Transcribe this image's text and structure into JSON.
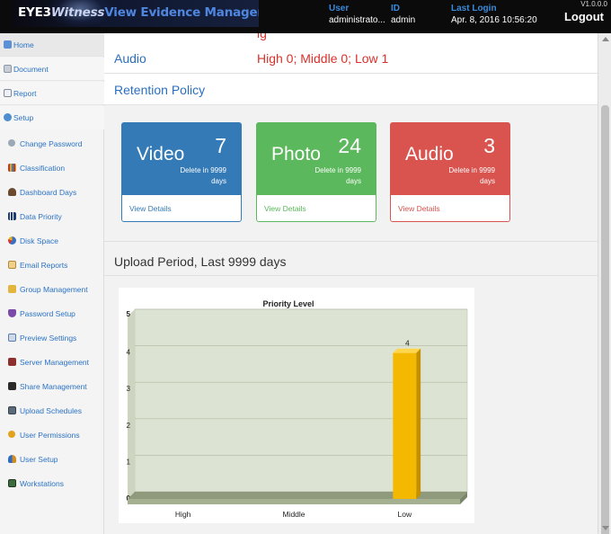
{
  "header": {
    "logo_eye": "EYE3",
    "logo_witness": "Witness",
    "logo_rest": "View Evidence Management Portal",
    "user_label": "User",
    "user_value": "administrato...",
    "id_label": "ID",
    "id_value": "admin",
    "login_label": "Last Login",
    "login_value": "Apr. 8, 2016 10:56:20",
    "version": "V1.0.0.0",
    "logout": "Logout"
  },
  "sidebar": {
    "top_items": [
      {
        "label": "Home",
        "icon": "home-icon"
      },
      {
        "label": "Document",
        "icon": "document-icon"
      },
      {
        "label": "Report",
        "icon": "report-icon"
      },
      {
        "label": "Setup",
        "icon": "setup-icon"
      }
    ],
    "sub_items": [
      {
        "label": "Change Password",
        "icon": "key-icon"
      },
      {
        "label": "Classification",
        "icon": "grid-icon"
      },
      {
        "label": "Dashboard Days",
        "icon": "user-icon"
      },
      {
        "label": "Data Priority",
        "icon": "bar-chart-icon"
      },
      {
        "label": "Disk Space",
        "icon": "pie-chart-icon"
      },
      {
        "label": "Email Reports",
        "icon": "email-icon"
      },
      {
        "label": "Group Management",
        "icon": "folder-icon"
      },
      {
        "label": "Password Setup",
        "icon": "shield-icon"
      },
      {
        "label": "Preview Settings",
        "icon": "preview-icon"
      },
      {
        "label": "Server Management",
        "icon": "server-icon"
      },
      {
        "label": "Share Management",
        "icon": "share-icon"
      },
      {
        "label": "Upload Schedules",
        "icon": "calendar-icon"
      },
      {
        "label": "User Permissions",
        "icon": "key-icon"
      },
      {
        "label": "User Setup",
        "icon": "users-icon"
      },
      {
        "label": "Workstations",
        "icon": "workstation-icon"
      }
    ]
  },
  "main": {
    "audio_label": "Audio",
    "audio_value": "High 0; Middle 0; Low 1",
    "retention_title": "Retention Policy",
    "tiles": [
      {
        "name": "Video",
        "count": "7",
        "desc": "Delete in 9999 days",
        "link": "View Details",
        "color": "#337ab7",
        "link_color": "#337ab7"
      },
      {
        "name": "Photo",
        "count": "24",
        "desc": "Delete in 9999 days",
        "link": "View Details",
        "color": "#5cb85c",
        "link_color": "#5cb85c"
      },
      {
        "name": "Audio",
        "count": "3",
        "desc": "Delete in 9999 days",
        "link": "View Details",
        "color": "#d9534f",
        "link_color": "#d9534f"
      }
    ],
    "upload_title": "Upload Period, Last 9999 days"
  },
  "chart_data": {
    "type": "bar",
    "title": "Priority Level",
    "categories": [
      "High",
      "Middle",
      "Low"
    ],
    "values": [
      0,
      0,
      4
    ],
    "data_labels": [
      "",
      "",
      "4"
    ],
    "ylim": [
      0,
      5
    ],
    "yticks": [
      "0",
      "1",
      "2",
      "3",
      "4",
      "5"
    ],
    "grid": true,
    "bar_color": "#f5b800",
    "plot_bg": "#dde3d2"
  }
}
